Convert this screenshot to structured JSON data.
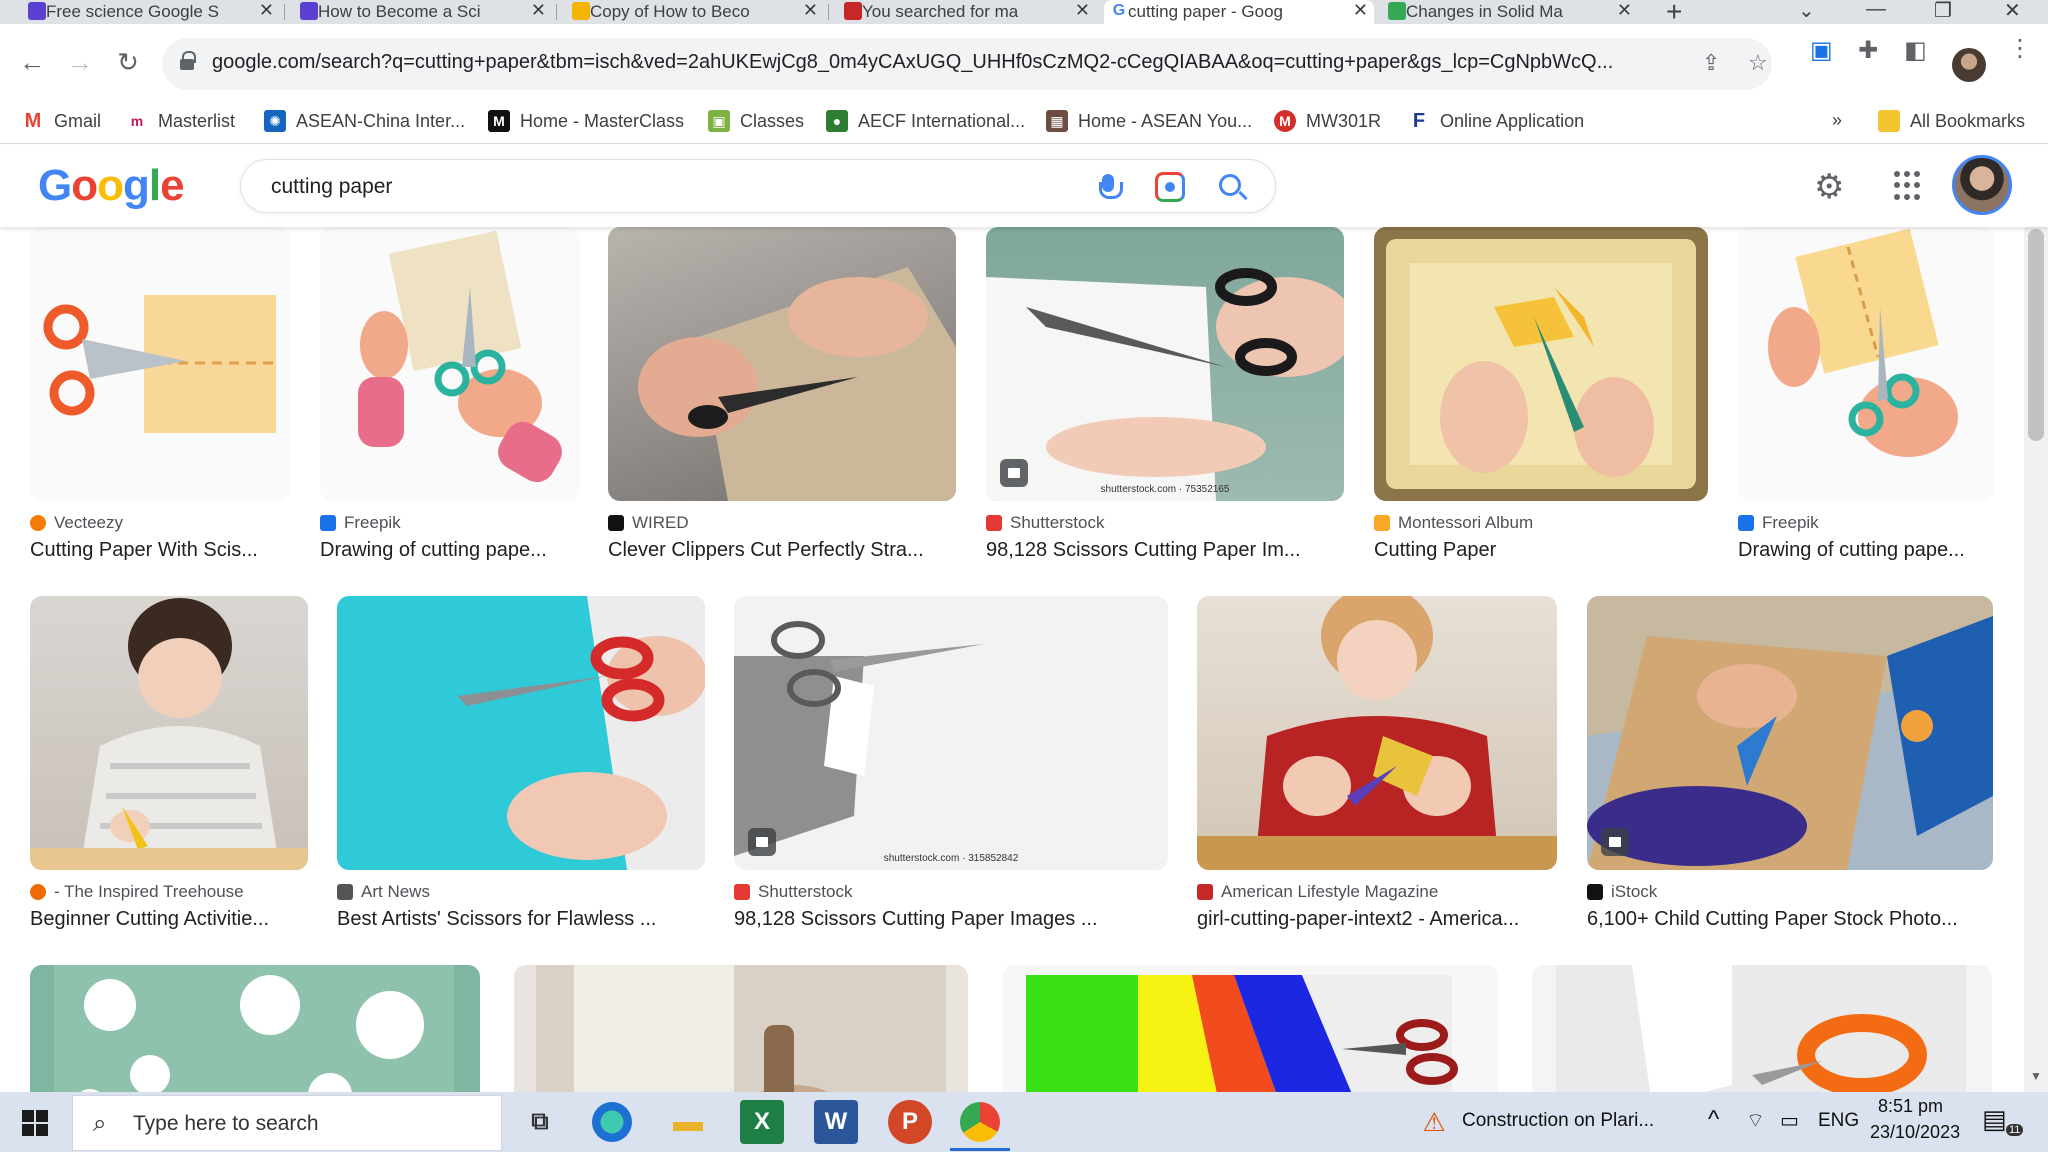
{
  "browser": {
    "tabs": [
      {
        "title": "Free science Google S",
        "color": "#5b3fd1"
      },
      {
        "title": "How to Become a Sci",
        "color": "#5b3fd1"
      },
      {
        "title": "Copy of How to Beco",
        "color": "#f4b400"
      },
      {
        "title": "You searched for ma",
        "color": "#c62828"
      },
      {
        "title": "cutting paper - Goog",
        "color": "#4285f4"
      },
      {
        "title": "Changes in Solid Ma",
        "color": "#34a853"
      }
    ],
    "active_tab_index": 4,
    "url": "google.com/search?q=cutting+paper&tbm=isch&ved=2ahUKEwjCg8_0m4yCAxUGQ_UHHf0sCzMQ2-cCegQIABAA&oq=cutting+paper&gs_lcp=CgNpbWcQ..."
  },
  "bookmarks": [
    {
      "label": "Gmail",
      "color": "#ea4335",
      "glyph": "M"
    },
    {
      "label": "Masterlist",
      "color": "#c2185b",
      "glyph": "m"
    },
    {
      "label": "ASEAN-China Inter...",
      "color": "#1565c0",
      "glyph": "✺"
    },
    {
      "label": "Home - MasterClass",
      "color": "#111111",
      "glyph": "M"
    },
    {
      "label": "Classes",
      "color": "#7cb342",
      "glyph": "▣"
    },
    {
      "label": "AECF International...",
      "color": "#2e7d32",
      "glyph": "●"
    },
    {
      "label": "Home - ASEAN You...",
      "color": "#6d4c41",
      "glyph": "▦"
    },
    {
      "label": "MW301R",
      "color": "#d32f2f",
      "glyph": "M"
    },
    {
      "label": "Online Application",
      "color": "#1e3a8a",
      "glyph": "F"
    }
  ],
  "bookmarks_more": "»",
  "all_bookmarks": "All Bookmarks",
  "search": {
    "logo": [
      "G",
      "o",
      "o",
      "g",
      "l",
      "e"
    ],
    "logo_colors": [
      "#4285f4",
      "#ea4335",
      "#fbbc05",
      "#4285f4",
      "#34a853",
      "#ea4335"
    ],
    "query": "cutting paper"
  },
  "results": [
    {
      "source": "Vecteezy",
      "title": "Cutting Paper With Scis...",
      "fav": "#f57c00"
    },
    {
      "source": "Freepik",
      "title": "Drawing of cutting pape...",
      "fav": "#1a73e8"
    },
    {
      "source": "WIRED",
      "title": "Clever Clippers Cut Perfectly Stra...",
      "fav": "#111111"
    },
    {
      "source": "Shutterstock",
      "title": "98,128 Scissors Cutting Paper Im...",
      "fav": "#e53935",
      "watermark": "shutterstock.com · 75352165"
    },
    {
      "source": "Montessori Album",
      "title": "Cutting Paper",
      "fav": "#f9a825"
    },
    {
      "source": "Freepik",
      "title": "Drawing of cutting pape...",
      "fav": "#1a73e8"
    },
    {
      "source": "- The Inspired Treehouse",
      "title": "Beginner Cutting Activitie...",
      "fav": "#ef6c00"
    },
    {
      "source": "Art News",
      "title": "Best Artists' Scissors for Flawless ...",
      "fav": "#555555"
    },
    {
      "source": "Shutterstock",
      "title": "98,128 Scissors Cutting Paper Images ...",
      "fav": "#e53935",
      "watermark": "shutterstock.com · 315852842"
    },
    {
      "source": "American Lifestyle Magazine",
      "title": "girl-cutting-paper-intext2 - America...",
      "fav": "#c62828"
    },
    {
      "source": "iStock",
      "title": "6,100+ Child Cutting Paper Stock Photo...",
      "fav": "#111111"
    }
  ],
  "taskbar": {
    "search_placeholder": "Type here to search",
    "notification": "Construction on Plari...",
    "lang": "ENG",
    "time": "8:51 pm",
    "date": "23/10/2023",
    "notif_count": "11"
  },
  "colors": {
    "accent": "#4285f4",
    "taskbar": "#d9e2ee"
  }
}
